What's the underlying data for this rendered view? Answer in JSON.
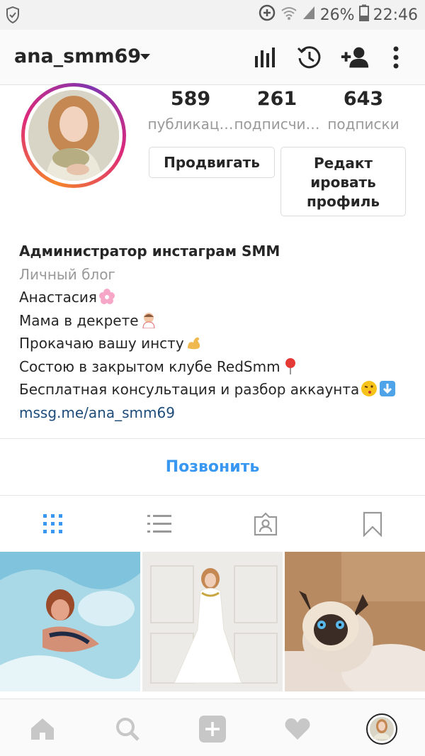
{
  "status_bar": {
    "battery": "26%",
    "time": "22:46",
    "icons": [
      "shield-icon",
      "data-saver-icon",
      "wifi-icon",
      "signal-icon",
      "battery-icon"
    ]
  },
  "header": {
    "username": "ana_smm69",
    "icons": [
      "insights-icon",
      "archive-history-icon",
      "add-person-icon",
      "more-options-icon"
    ]
  },
  "profile": {
    "stats": [
      {
        "value": "589",
        "label": "публикац…"
      },
      {
        "value": "261",
        "label": "подписчи…"
      },
      {
        "value": "643",
        "label": "подписки"
      }
    ],
    "promote_label": "Продвигать",
    "edit_label_lines": [
      "Редакт",
      "ировать",
      "профиль"
    ]
  },
  "bio": {
    "name": "Администратор инстаграм SMM",
    "category": "Личный блог",
    "lines": [
      {
        "text": "Анастасия",
        "emoji": "cherry-blossom"
      },
      {
        "text": "Мама в декрете",
        "emoji": "baby"
      },
      {
        "text": "Прокачаю вашу инсту",
        "emoji": "flexed-biceps"
      },
      {
        "text": "Состою в закрытом клубе RedSmm",
        "emoji": "pin"
      },
      {
        "text": "Бесплатная консультация и разбор аккаунта",
        "emoji": "wink-kiss",
        "emoji2": "down-arrow"
      }
    ],
    "link": "mssg.me/ana_smm69"
  },
  "call_button": "Позвонить",
  "tabs": [
    "grid-icon",
    "list-icon",
    "tagged-icon",
    "saved-icon"
  ],
  "grid": [
    "pool-photo",
    "white-dress-photo",
    "siamese-cat-photo"
  ],
  "bottom_nav": [
    "home-icon",
    "search-icon",
    "add-icon",
    "heart-icon",
    "profile-avatar"
  ],
  "colors": {
    "accent": "#3897f0",
    "link": "#1e4c7a",
    "muted": "#999999"
  }
}
